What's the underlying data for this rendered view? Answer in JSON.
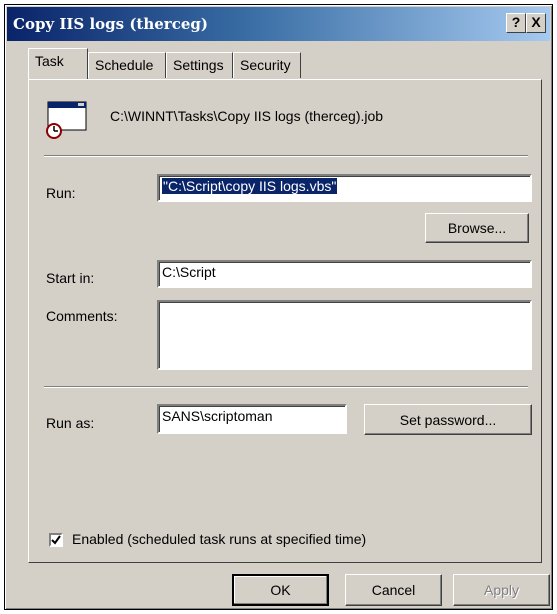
{
  "window": {
    "title": "Copy IIS logs (therceg)",
    "help_label": "?",
    "close_label": "X"
  },
  "tabs": [
    {
      "label": "Task",
      "active": true
    },
    {
      "label": "Schedule",
      "active": false
    },
    {
      "label": "Settings",
      "active": false
    },
    {
      "label": "Security",
      "active": false
    }
  ],
  "task": {
    "file_path": "C:\\WINNT\\Tasks\\Copy IIS logs (therceg).job",
    "run_label": "Run:",
    "run_value": "\"C:\\Script\\copy IIS logs.vbs\"",
    "browse_label": "Browse...",
    "start_in_label": "Start in:",
    "start_in_value": "C:\\Script",
    "comments_label": "Comments:",
    "comments_value": "",
    "run_as_label": "Run as:",
    "run_as_value": "SANS\\scriptoman",
    "set_password_label": "Set password...",
    "enabled_label": "Enabled (scheduled task runs at specified time)",
    "enabled_checked": true
  },
  "footer": {
    "ok_label": "OK",
    "cancel_label": "Cancel",
    "apply_label": "Apply"
  },
  "colors": {
    "title_gradient_start": "#0a246a",
    "title_gradient_end": "#a6caf0",
    "dialog_face": "#d4d0c8",
    "selection": "#0a246a"
  }
}
